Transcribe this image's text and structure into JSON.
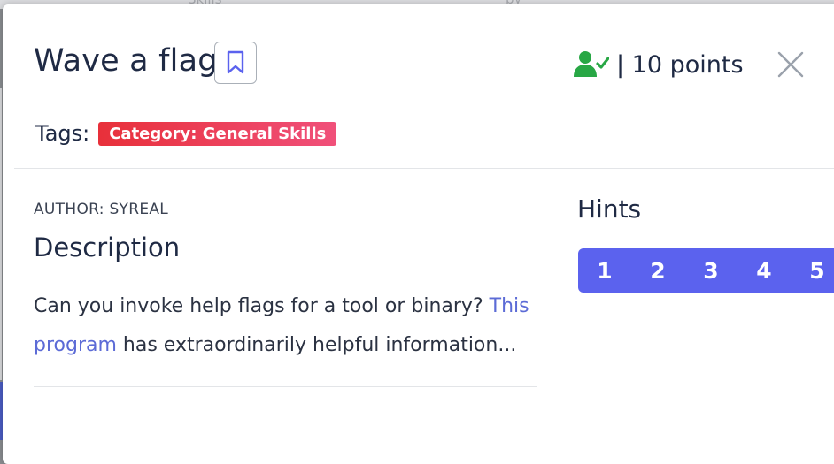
{
  "background": {
    "peek_text_left": "Skills",
    "peek_text_right": "by"
  },
  "modal": {
    "title": "Wave a flag",
    "bookmark_icon": "bookmark-icon",
    "solved_icon": "user-check-icon",
    "points_text": "| 10 points",
    "close_icon": "close-icon",
    "tags_label": "Tags:",
    "tags": [
      {
        "label": "Category: General Skills"
      }
    ],
    "author": "AUTHOR: SYREAL",
    "description_heading": "Description",
    "description": {
      "before_link": "Can you invoke help flags for a tool or binary? ",
      "link_text": "This program",
      "after_link": " has extraordinarily helpful information..."
    },
    "hints_heading": "Hints",
    "hints": [
      "1",
      "2",
      "3",
      "4",
      "5"
    ]
  },
  "colors": {
    "accent": "#5b62ee",
    "tag_start": "#e8303a",
    "tag_end": "#f0507a",
    "link": "#5c6bd6",
    "solved_green": "#28a745"
  }
}
